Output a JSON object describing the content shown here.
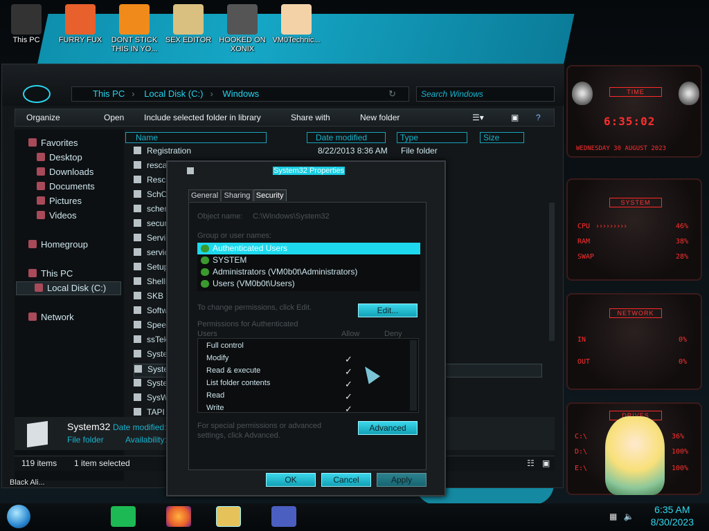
{
  "desktop": {
    "icons": [
      {
        "label": "This PC",
        "color": "#333"
      },
      {
        "label": "FURRY FUX",
        "color": "#e8602b"
      },
      {
        "label": "DONT STICK THIS IN YO...",
        "color": "#f08a1a"
      },
      {
        "label": "SEX EDITOR",
        "color": "#d9c080"
      },
      {
        "label": "HOOKED ON XONIX",
        "color": "#555"
      },
      {
        "label": "VM0Technic...",
        "color": "#f3d2a8"
      }
    ],
    "bottom_label": "Black Ali..."
  },
  "explorer": {
    "breadcrumb": [
      "This PC",
      "Local Disk (C:)",
      "Windows"
    ],
    "search_placeholder": "Search Windows",
    "toolbar": {
      "organize": "Organize",
      "open": "Open",
      "include": "Include selected folder in library",
      "share": "Share with",
      "new_folder": "New folder"
    },
    "nav": {
      "favorites": "Favorites",
      "desktop": "Desktop",
      "downloads": "Downloads",
      "documents": "Documents",
      "pictures": "Pictures",
      "videos": "Videos",
      "homegroup": "Homegroup",
      "this_pc": "This PC",
      "local_disk": "Local Disk (C:)",
      "network": "Network"
    },
    "columns": {
      "name": "Name",
      "date": "Date modified",
      "type": "Type",
      "size": "Size"
    },
    "rows": [
      {
        "name": "Registration",
        "date": "8/22/2013 8:36 AM",
        "type": "File folder"
      },
      {
        "name": "resca",
        "date": "",
        "type": ""
      },
      {
        "name": "Resc",
        "date": "",
        "type": ""
      },
      {
        "name": "SchC",
        "date": "",
        "type": ""
      },
      {
        "name": "schem",
        "date": "",
        "type": ""
      },
      {
        "name": "securi",
        "date": "",
        "type": ""
      },
      {
        "name": "Servic",
        "date": "",
        "type": ""
      },
      {
        "name": "servici",
        "date": "",
        "type": ""
      },
      {
        "name": "Setup",
        "date": "",
        "type": ""
      },
      {
        "name": "ShellN",
        "date": "",
        "type": ""
      },
      {
        "name": "SKB",
        "date": "",
        "type": ""
      },
      {
        "name": "Softwa",
        "date": "",
        "type": ""
      },
      {
        "name": "Speec",
        "date": "",
        "type": ""
      },
      {
        "name": "ssTek",
        "date": "",
        "type": ""
      },
      {
        "name": "Syster",
        "date": "",
        "type": ""
      },
      {
        "name": "Syster",
        "date": "",
        "type": ""
      },
      {
        "name": "Syster",
        "date": "",
        "type": ""
      },
      {
        "name": "SysWC",
        "date": "",
        "type": ""
      },
      {
        "name": "TAPI",
        "date": "",
        "type": ""
      }
    ],
    "details": {
      "name": "System32",
      "date_label": "Date modified:",
      "type": "File folder",
      "avail_label": "Availability:"
    },
    "status": {
      "items": "119 items",
      "selected": "1 item selected"
    }
  },
  "dialog": {
    "title": "System32 Properties",
    "tabs": [
      "General",
      "Sharing",
      "Security"
    ],
    "object_label": "Object name:",
    "object_value": "C:\\Windows\\System32",
    "group_label": "Group or user names:",
    "users": [
      "Authenticated Users",
      "SYSTEM",
      "Administrators (VM0b0t\\Administrators)",
      "Users (VM0b0t\\Users)"
    ],
    "change_hint": "To change permissions, click Edit.",
    "edit_btn": "Edit...",
    "perm_label": "Permissions for Authenticated",
    "perm_label2": "Users",
    "allow": "Allow",
    "deny": "Deny",
    "permissions": [
      {
        "name": "Full control",
        "allow": ""
      },
      {
        "name": "Modify",
        "allow": "✓"
      },
      {
        "name": "Read & execute",
        "allow": "✓"
      },
      {
        "name": "List folder contents",
        "allow": "✓"
      },
      {
        "name": "Read",
        "allow": "✓"
      },
      {
        "name": "Write",
        "allow": "✓"
      }
    ],
    "special_hint": "For special permissions or advanced settings, click Advanced.",
    "advanced_btn": "Advanced",
    "ok": "OK",
    "cancel": "Cancel",
    "apply": "Apply"
  },
  "gadgets": {
    "time": {
      "title": "TIME",
      "clock": "6:35:02",
      "date": "WEDNESDAY 30 AUGUST 2023"
    },
    "system": {
      "title": "SYSTEM",
      "cpu_label": "CPU",
      "cpu": "46%",
      "ram_label": "RAM",
      "ram": "38%",
      "swap_label": "SWAP",
      "swap": "28%"
    },
    "network": {
      "title": "NETWORK",
      "in_label": "IN",
      "in": "0%",
      "out_label": "OUT",
      "out": "0%"
    },
    "drives": {
      "title": "DRIVES",
      "c_label": "C:\\",
      "c": "36%",
      "d_label": "D:\\",
      "d": "100%",
      "e_label": "E:\\",
      "e": "100%"
    }
  },
  "taskbar": {
    "time": "6:35 AM",
    "date": "8/30/2023"
  }
}
